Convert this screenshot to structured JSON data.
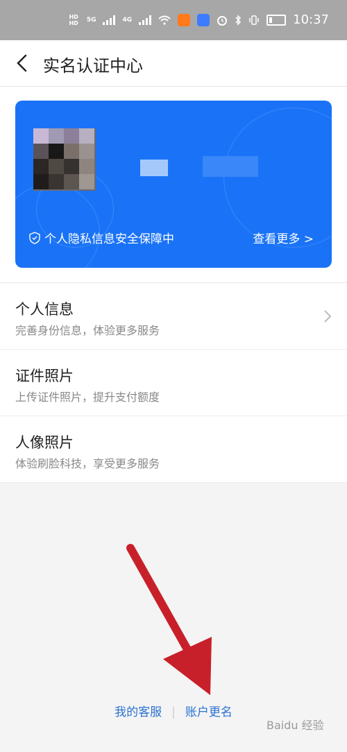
{
  "status_bar": {
    "time": "10:37",
    "left_badge_top": "HD",
    "left_badge_bottom": "HD",
    "net1": "5G",
    "net2": "4G"
  },
  "header": {
    "title": "实名认证中心"
  },
  "card": {
    "privacy_text": "个人隐私信息安全保障中",
    "more_text": "查看更多 >",
    "accent_color": "#1a73f7"
  },
  "list": [
    {
      "title": "个人信息",
      "subtitle": "完善身份信息，体验更多服务"
    },
    {
      "title": "证件照片",
      "subtitle": "上传证件照片，提升支付额度"
    },
    {
      "title": "人像照片",
      "subtitle": "体验刷脸科技，享受更多服务"
    }
  ],
  "footer": {
    "link1": "我的客服",
    "divider": "|",
    "link2": "账户更名"
  },
  "watermark": {
    "text": "Baidu 经验"
  },
  "icons": {
    "back": "back-arrow-icon",
    "shield": "shield-icon",
    "chevron": "chevron-right-icon"
  }
}
